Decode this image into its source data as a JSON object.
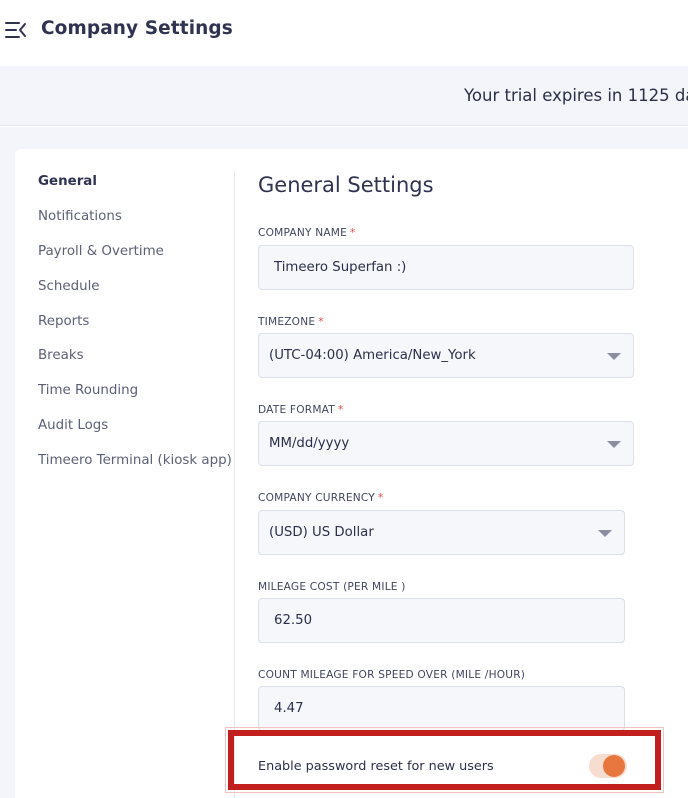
{
  "header": {
    "title": "Company Settings",
    "menu_icon": "menu-collapse-icon"
  },
  "banner": {
    "text": "Your trial expires in 1125 da"
  },
  "sidebar": {
    "items": [
      {
        "label": "General",
        "active": true
      },
      {
        "label": "Notifications"
      },
      {
        "label": "Payroll & Overtime"
      },
      {
        "label": "Schedule"
      },
      {
        "label": "Reports"
      },
      {
        "label": "Breaks"
      },
      {
        "label": "Time Rounding"
      },
      {
        "label": "Audit Logs"
      },
      {
        "label": "Timeero Terminal (kiosk app)"
      }
    ]
  },
  "main": {
    "title": "General Settings",
    "required_marker": "*",
    "fields": {
      "company_name": {
        "label": "COMPANY NAME",
        "value": "Timeero Superfan :)"
      },
      "timezone": {
        "label": "TIMEZONE",
        "value": "(UTC-04:00) America/New_York"
      },
      "date_format": {
        "label": "DATE FORMAT",
        "value": "MM/dd/yyyy"
      },
      "currency": {
        "label": "COMPANY CURRENCY",
        "value": "(USD) US Dollar"
      },
      "mileage_cost": {
        "label": "MILEAGE COST (PER MILE )",
        "value": "62.50"
      },
      "mileage_speed": {
        "label": "COUNT MILEAGE FOR SPEED OVER (MILE /HOUR)",
        "value": "4.47"
      }
    },
    "password_reset": {
      "label": "Enable password reset for new users",
      "enabled": true
    }
  },
  "colors": {
    "accent_toggle": "#e7773e",
    "highlight_border": "#c41f1f",
    "required": "#e24b4b"
  }
}
